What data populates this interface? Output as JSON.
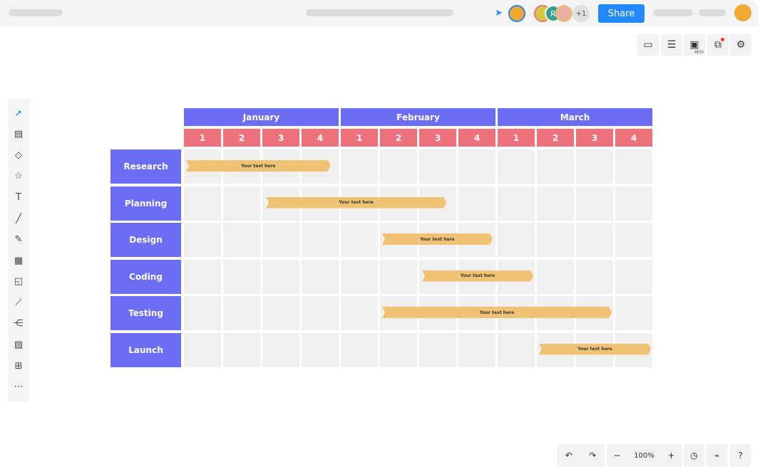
{
  "topbar": {
    "share_label": "Share",
    "extra_collaborators": "+1",
    "collab_initial": "R"
  },
  "toolbar_right": {
    "beta_label": "BETA"
  },
  "zoom": {
    "level": "100%"
  },
  "chart_data": {
    "type": "gantt",
    "months": [
      "January",
      "February",
      "March"
    ],
    "weeks": [
      "1",
      "2",
      "3",
      "4",
      "1",
      "2",
      "3",
      "4",
      "1",
      "2",
      "3",
      "4"
    ],
    "tasks": [
      {
        "name": "Research",
        "start": 0.07,
        "end": 3.76,
        "text": "Your text here"
      },
      {
        "name": "Planning",
        "start": 2.11,
        "end": 6.71,
        "text": "Your text here"
      },
      {
        "name": "Design",
        "start": 5.07,
        "end": 7.89,
        "text": "Your text here"
      },
      {
        "name": "Coding",
        "start": 6.09,
        "end": 8.93,
        "text": "Your text here"
      },
      {
        "name": "Testing",
        "start": 5.07,
        "end": 10.93,
        "text": "Your text here"
      },
      {
        "name": "Launch",
        "start": 9.07,
        "end": 11.93,
        "text": "Your text here"
      }
    ],
    "colors": {
      "month": "#6b6ef2",
      "week": "#ee727d",
      "bar": "#f0c274",
      "cell": "#f0f0f0"
    }
  }
}
